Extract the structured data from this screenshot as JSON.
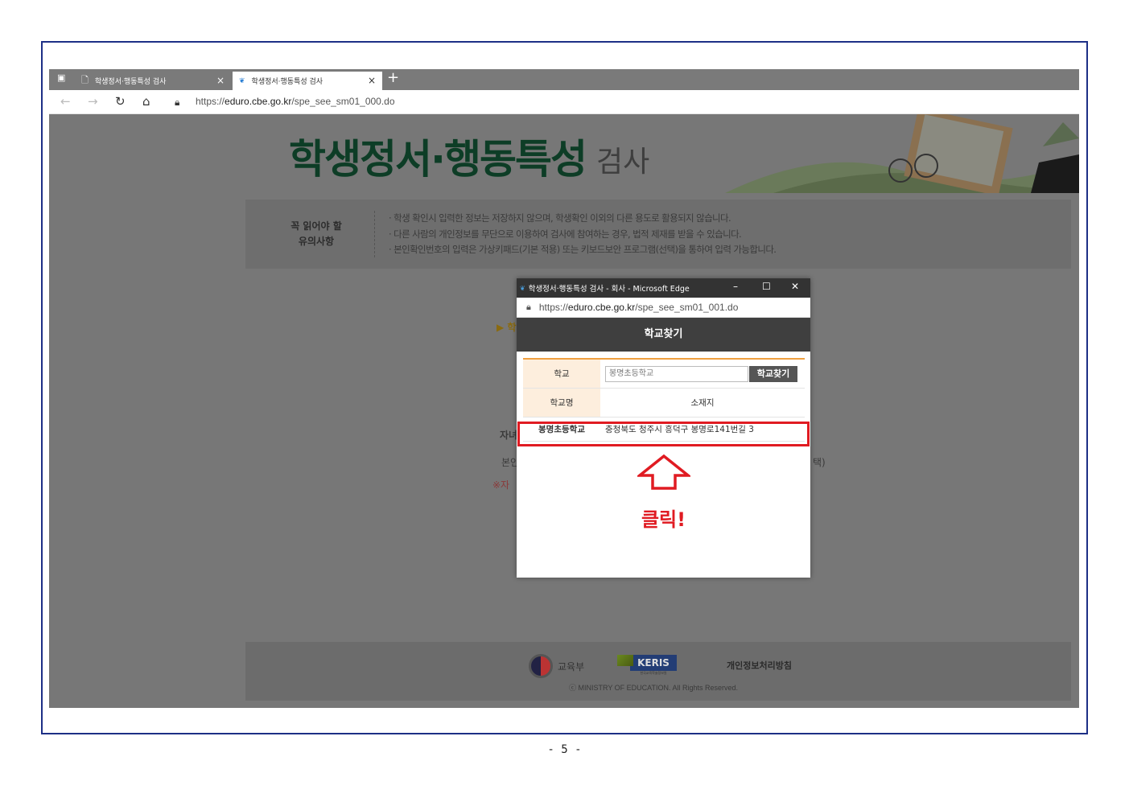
{
  "browser": {
    "tabs": [
      {
        "label": "학생정서·행동특성 검사",
        "close": "×"
      },
      {
        "label": "학생정서·행동특성 검사",
        "close": "×"
      }
    ],
    "new_tab": "+",
    "url_prefix": "https://",
    "url_host": "eduro.cbe.go.kr",
    "url_path": "/spe_see_sm01_000.do"
  },
  "page": {
    "title": "학생정서·행동특성",
    "title_suffix": "검사",
    "notice_title_line1": "꼭 읽어야 할",
    "notice_title_line2": "유의사항",
    "notices": [
      "· 학생 확인시 입력한 정보는 저장하지 않으며, 학생확인 이외의 다른 용도로 활용되지 않습니다.",
      "· 다른 사람의 개인정보를 무단으로 이용하여 검사에 참여하는 경우, 법적 제재를 받을 수 있습니다.",
      "· 본인확인번호의 입력은 가상키패드(기본 적용) 또는 키보드보안 프로그램(선택)을 통하여 입력 가능합니다."
    ],
    "ghost_1": "▶ 학",
    "ghost_2": "자녀",
    "ghost_3": "본인",
    "ghost_4": "※자",
    "ghost_5": "택)"
  },
  "footer": {
    "moe": "교육부",
    "keris": "KERIS",
    "keris_sub": "한국교육학술정보원",
    "privacy": "개인정보처리방침",
    "copyright": "ⓒ MINISTRY OF EDUCATION. All Rights Reserved."
  },
  "popup": {
    "window_title": "학생정서·행동특성 검사 - 회사 - Microsoft Edge",
    "url_prefix": "https://",
    "url_host": "eduro.cbe.go.kr",
    "url_path": "/spe_see_sm01_001.do",
    "header": "학교찾기",
    "school_label": "학교",
    "school_value": "봉명초등학교",
    "search_button": "학교찾기",
    "col_name": "학교명",
    "col_location": "소재지",
    "result_name": "봉명초등학교",
    "result_location": "충청북도 청주시 흥덕구 봉명로141번길 3",
    "click_label": "클릭!"
  },
  "page_number": "- 5 -",
  "colors": {
    "highlight": "#e01b22",
    "title_green": "#0d3d26",
    "frame_border": "#1d2f86"
  }
}
